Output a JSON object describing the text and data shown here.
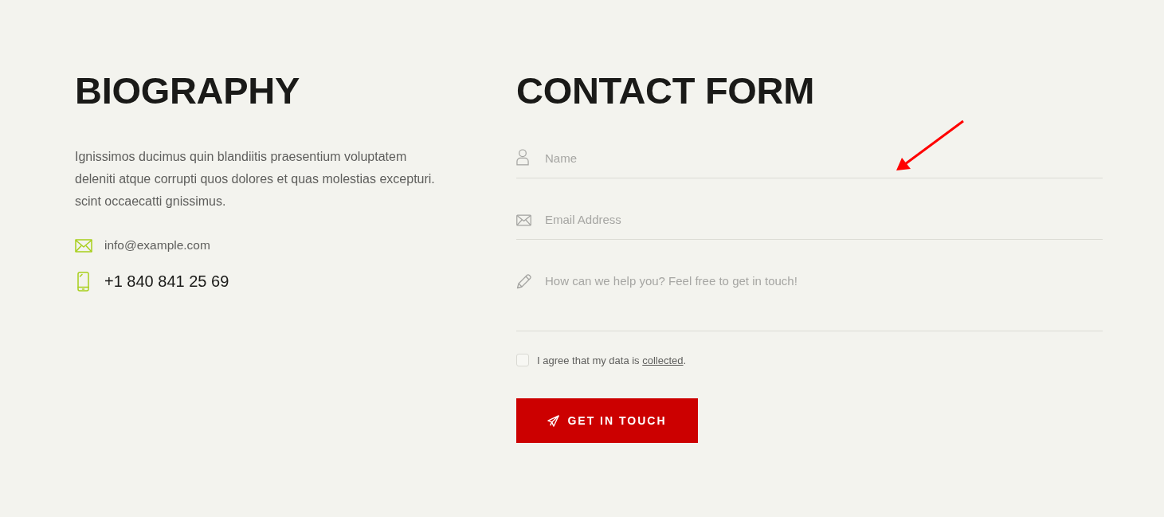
{
  "biography": {
    "title": "BIOGRAPHY",
    "text": "Ignissimos ducimus quin blandiitis praesentium voluptatem deleniti atque corrupti quos dolores et quas molestias excepturi. scint occaecatti gnissimus.",
    "contacts": [
      {
        "kind": "email",
        "text": "info@example.com"
      },
      {
        "kind": "phone",
        "text": "+1 840 841 25 69"
      }
    ]
  },
  "contact_form": {
    "title": "CONTACT FORM",
    "fields": [
      {
        "kind": "name",
        "placeholder": "Name"
      },
      {
        "kind": "email",
        "placeholder": "Email Address"
      },
      {
        "kind": "message",
        "placeholder": "How can we help you? Feel free to get in touch!"
      }
    ],
    "consent": {
      "checked": false,
      "text": "I agree that my data is",
      "link": "collected",
      "after": "."
    },
    "submit_button": {
      "label": "GET IN TOUCH"
    }
  }
}
